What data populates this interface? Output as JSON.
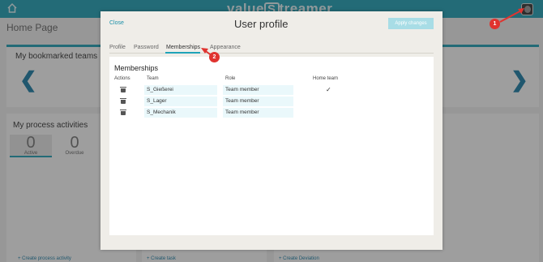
{
  "app": {
    "brand": "valueStreamer",
    "page_title": "Home Page"
  },
  "dashboard": {
    "bookmarks_title": "My bookmarked teams",
    "activities_title": "My process activities",
    "activities_tabs": [
      {
        "count": "0",
        "label": "Active"
      },
      {
        "count": "0",
        "label": "Overdue"
      }
    ],
    "create_process_activity": "+ Create process activity",
    "create_task": "+ Create task",
    "create_deviation": "+ Create Deviation"
  },
  "modal": {
    "close_label": "Close",
    "title": "User profile",
    "apply_label": "Apply changes",
    "tabs": [
      "Profile",
      "Password",
      "Memberships",
      "Appearance"
    ],
    "active_tab": "Memberships"
  },
  "memberships": {
    "title": "Memberships",
    "columns": [
      "Actions",
      "Team",
      "Role",
      "Home team"
    ],
    "rows": [
      {
        "team": "S_Gießerei",
        "role": "Team member",
        "home": "✓"
      },
      {
        "team": "S_Lager",
        "role": "Team member",
        "home": ""
      },
      {
        "team": "S_Mechanik",
        "role": "Team member",
        "home": ""
      }
    ]
  },
  "annotations": [
    "1",
    "2"
  ],
  "colors": {
    "accent": "#1fa3b8",
    "annotation": "#e0332f",
    "apply_button": "#a8dde6"
  }
}
